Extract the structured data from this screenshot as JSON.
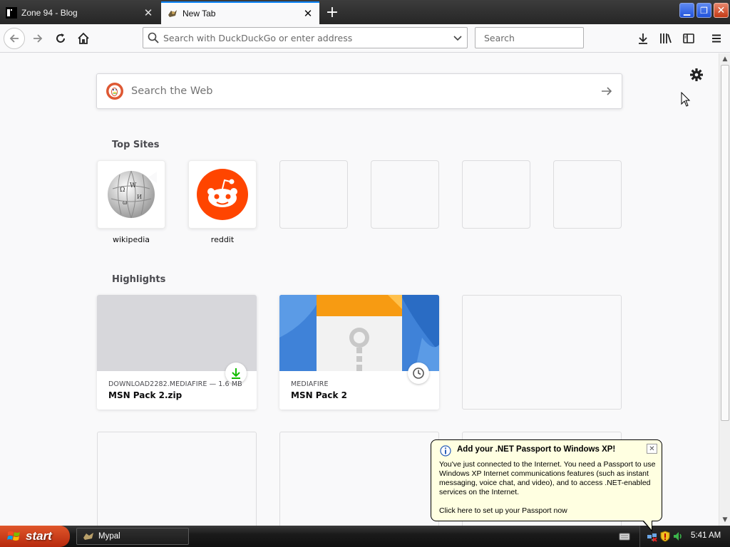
{
  "tabs": [
    {
      "title": "Zone 94 - Blog",
      "active": false
    },
    {
      "title": "New Tab",
      "active": true
    }
  ],
  "navbar": {
    "url_placeholder": "Search with DuckDuckGo or enter address",
    "search_placeholder": "Search"
  },
  "newtab": {
    "web_search_placeholder": "Search the Web",
    "top_sites_title": "Top Sites",
    "top_sites": [
      {
        "label": "wikipedia",
        "icon": "wikipedia-globe"
      },
      {
        "label": "reddit",
        "icon": "reddit-alien"
      },
      {
        "label": "",
        "icon": ""
      },
      {
        "label": "",
        "icon": ""
      },
      {
        "label": "",
        "icon": ""
      },
      {
        "label": "",
        "icon": ""
      }
    ],
    "highlights_title": "Highlights",
    "highlights": [
      {
        "context": "DOWNLOAD2282.MEDIAFIRE — 1.6 MB",
        "title": "MSN Pack 2.zip",
        "badge": "download-icon"
      },
      {
        "context": "MEDIAFIRE",
        "title": "MSN Pack 2",
        "badge": "clock-icon"
      }
    ]
  },
  "balloon": {
    "title": "Add your .NET Passport to Windows XP!",
    "body": "You've just connected to the Internet.  You need a Passport to use Windows XP Internet communications features (such as instant messaging, voice chat, and video), and to access .NET-enabled services on the Internet.",
    "link": "Click here to set up your Passport now"
  },
  "taskbar": {
    "start_label": "start",
    "tasks": [
      {
        "label": "Mypal"
      }
    ],
    "clock": "5:41 AM"
  },
  "colors": {
    "accent": "#0a84ff",
    "reddit": "#ff4500",
    "download_green": "#12bc00",
    "mediafire_blue": "#1f6fd0",
    "mediafire_orange": "#f79b12",
    "balloon_bg": "#ffffe1"
  }
}
